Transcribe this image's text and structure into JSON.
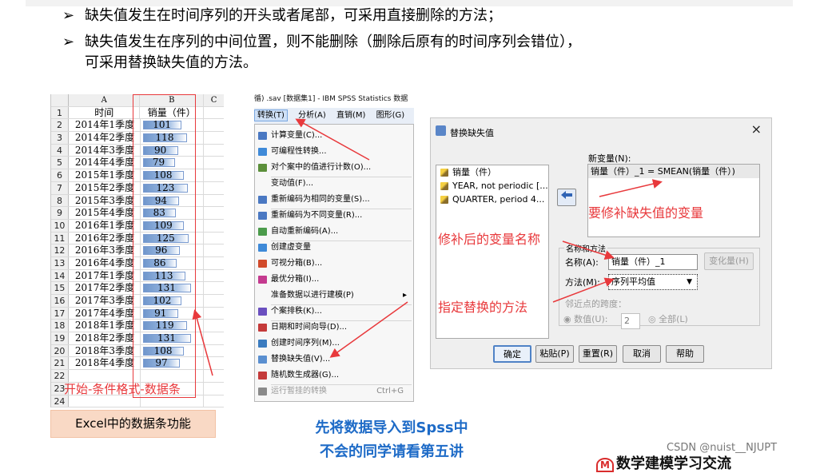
{
  "slide": {
    "bullets": [
      "缺失值发生在时间序列的开头或者尾部，可采用直接删除的方法；",
      "缺失值发生在序列的中间位置，则不能删除（删除后原有的时间序列会错位），",
      "可采用替换缺失值的方法。"
    ],
    "bullet_glyph": "➢"
  },
  "excel": {
    "col_headers": [
      "A",
      "B",
      "C"
    ],
    "header_row": {
      "num": "1",
      "a": "时间",
      "b": "销量（件）"
    },
    "rows": [
      {
        "num": "2",
        "a": "2014年1季度",
        "b": "101",
        "v": 101
      },
      {
        "num": "3",
        "a": "2014年2季度",
        "b": "118",
        "v": 118
      },
      {
        "num": "4",
        "a": "2014年3季度",
        "b": "90",
        "v": 90
      },
      {
        "num": "5",
        "a": "2014年4季度",
        "b": "79",
        "v": 79
      },
      {
        "num": "6",
        "a": "2015年1季度",
        "b": "108",
        "v": 108
      },
      {
        "num": "7",
        "a": "2015年2季度",
        "b": "123",
        "v": 123
      },
      {
        "num": "8",
        "a": "2015年3季度",
        "b": "94",
        "v": 94
      },
      {
        "num": "9",
        "a": "2015年4季度",
        "b": "83",
        "v": 83
      },
      {
        "num": "10",
        "a": "2016年1季度",
        "b": "109",
        "v": 109
      },
      {
        "num": "11",
        "a": "2016年2季度",
        "b": "125",
        "v": 125
      },
      {
        "num": "12",
        "a": "2016年3季度",
        "b": "96",
        "v": 96
      },
      {
        "num": "13",
        "a": "2016年4季度",
        "b": "86",
        "v": 86
      },
      {
        "num": "14",
        "a": "2017年1季度",
        "b": "113",
        "v": 113
      },
      {
        "num": "15",
        "a": "2017年2季度",
        "b": "131",
        "v": 131
      },
      {
        "num": "16",
        "a": "2017年3季度",
        "b": "102",
        "v": 102
      },
      {
        "num": "17",
        "a": "2017年4季度",
        "b": "91",
        "v": 91
      },
      {
        "num": "18",
        "a": "2018年1季度",
        "b": "119",
        "v": 119
      },
      {
        "num": "19",
        "a": "2018年2季度",
        "b": "131",
        "v": 131
      },
      {
        "num": "20",
        "a": "2018年3季度",
        "b": "108",
        "v": 108
      },
      {
        "num": "21",
        "a": "2018年4季度",
        "b": "97",
        "v": 97
      },
      {
        "num": "22",
        "a": "",
        "b": "",
        "v": null
      },
      {
        "num": "23",
        "a": "",
        "b": "",
        "v": null
      },
      {
        "num": "24",
        "a": "",
        "b": "",
        "v": null
      }
    ],
    "annotation": "开始-条件格式-数据条",
    "caption": "Excel中的数据条功能",
    "bar_color": "#6f96cc"
  },
  "spss_menu": {
    "title": "循) .sav [数据集1] - IBM SPSS Statistics 数据",
    "menubar": [
      "转换(T)",
      "分析(A)",
      "直销(M)",
      "图形(G)"
    ],
    "items": [
      {
        "label": "计算变量(C)...",
        "icon": "calculator-icon",
        "color": "#4a78c2"
      },
      {
        "label": "可编程性转换...",
        "icon": "plus-icon",
        "color": "#3f8ad8"
      },
      {
        "label": "对个案中的值进行计数(O)...",
        "icon": "count-icon",
        "color": "#5b8f3a"
      },
      {
        "label": "变动值(F)...",
        "icon": "",
        "color": ""
      },
      {
        "label": "重新编码为相同的变量(S)...",
        "icon": "recode-icon",
        "color": "#4a78c2"
      },
      {
        "label": "重新编码为不同变量(R)...",
        "icon": "recode-icon",
        "color": "#4a78c2"
      },
      {
        "label": "自动重新编码(A)...",
        "icon": "autorecode-icon",
        "color": "#4b9b4b"
      },
      {
        "label": "创建虚变量",
        "icon": "plus-icon",
        "color": "#3f8ad8"
      },
      {
        "label": "可视分箱(B)...",
        "icon": "binning-icon",
        "color": "#d14a2a"
      },
      {
        "label": "最优分箱(I)...",
        "icon": "optimal-binning-icon",
        "color": "#c43a8f"
      },
      {
        "label": "准备数据以进行建模(P)",
        "icon": "",
        "color": "",
        "submenu": "▸"
      },
      {
        "label": "个案排秩(K)...",
        "icon": "rank-icon",
        "color": "#6a4fbf"
      },
      {
        "label": "日期和时间向导(D)...",
        "icon": "calendar-icon",
        "color": "#c43a3a"
      },
      {
        "label": "创建时间序列(M)...",
        "icon": "timeseries-icon",
        "color": "#3a7bbf"
      },
      {
        "label": "替换缺失值(V)...",
        "icon": "replace-missing-icon",
        "color": "#5a8fd0"
      },
      {
        "label": "随机数生成器(G)...",
        "icon": "dice-icon",
        "color": "#c43a3a"
      },
      {
        "label": "运行暂挂的转换",
        "icon": "run-pending-icon",
        "color": "#8a8a8a",
        "shortcut": "Ctrl+G",
        "disabled": true
      }
    ]
  },
  "dialog": {
    "title": "替换缺失值",
    "close": "×",
    "variables": [
      "销量（件）",
      "YEAR, not periodic [...",
      "QUARTER, period 4..."
    ],
    "new_variable_label": "新变量(N):",
    "new_variable_value": "销量（件）_1 = SMEAN(销量（件）)",
    "group_label": "名称和方法",
    "name_label": "名称(A):",
    "name_value": "销量（件）_1",
    "change_button": "变化量(H)",
    "method_label": "方法(M):",
    "method_value": "序列平均值",
    "span_label": "邻近点的跨度：",
    "span_number_label": "数值(U):",
    "span_number_value": "2",
    "span_all_label": "全部(L)",
    "buttons": [
      "确定",
      "粘贴(P)",
      "重置(R)",
      "取消",
      "帮助"
    ]
  },
  "annotations": {
    "new_var": "要修补缺失值的变量",
    "renamed": "修补后的变量名称",
    "method": "指定替换的方法"
  },
  "footer": {
    "line1": "先将数据导入到Spss中",
    "line2": "不会的同学请看第五讲",
    "watermark": "CSDN @nuist__NJUPT",
    "logo_text": "数学建模学习交流",
    "logo_seal": "M"
  }
}
